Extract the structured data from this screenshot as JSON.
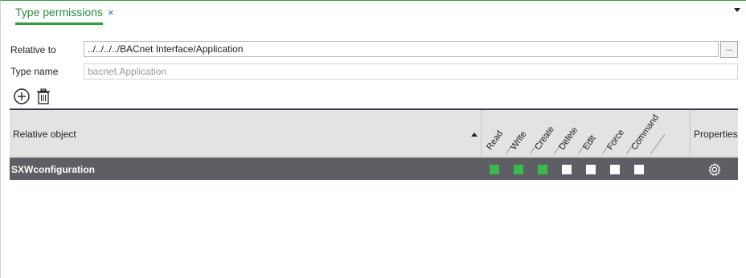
{
  "tab": {
    "title": "Type permissions",
    "close_glyph": "×"
  },
  "form": {
    "relative_to_label": "Relative to",
    "relative_to_value": "../../../../BACnet Interface/Application",
    "browse_label": "...",
    "type_name_label": "Type name",
    "type_name_value": "bacnet.Application"
  },
  "toolbar": {
    "add_icon": "add-circle-icon",
    "delete_icon": "trash-icon"
  },
  "table": {
    "col_relative_object": "Relative object",
    "col_properties": "Properties",
    "permission_headers": [
      "Read",
      "Write",
      "Create",
      "Delete",
      "Edit",
      "Force",
      "Command"
    ],
    "rows": [
      {
        "name": "SXWconfiguration",
        "permissions": [
          true,
          true,
          true,
          false,
          false,
          false,
          false
        ]
      }
    ]
  },
  "colors": {
    "accent": "#2e9e44",
    "row_selected": "#5e5e65",
    "perm_on": "#3ab94d",
    "perm_off": "#ffffff"
  }
}
